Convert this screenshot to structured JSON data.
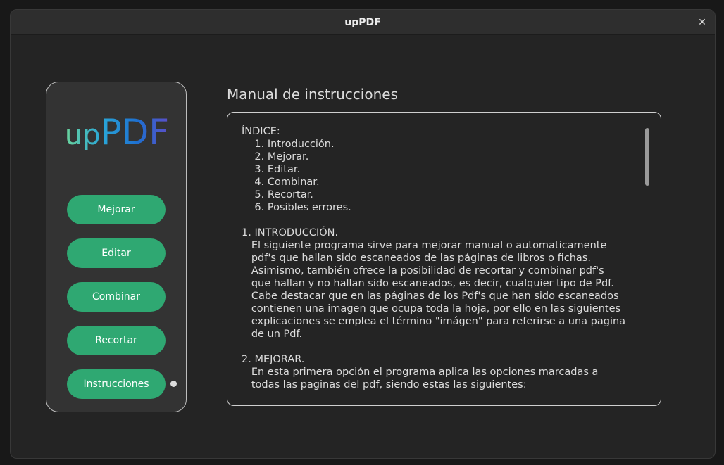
{
  "window": {
    "title": "upPDF",
    "minimize_glyph": "–",
    "close_glyph": "✕"
  },
  "sidebar": {
    "logo_text_left": "up",
    "logo_text_right": "PDF",
    "buttons": [
      {
        "label": "Mejorar"
      },
      {
        "label": "Editar"
      },
      {
        "label": "Combinar"
      },
      {
        "label": "Recortar"
      },
      {
        "label": "Instrucciones"
      }
    ]
  },
  "main": {
    "title": "Manual de instrucciones",
    "document_text": "ÍNDICE:\n    1. Introducción.\n    2. Mejorar.\n    3. Editar.\n    4. Combinar.\n    5. Recortar.\n    6. Posibles errores.\n\n1. INTRODUCCIÓN.\n   El siguiente programa sirve para mejorar manual o automaticamente\n   pdf's que hallan sido escaneados de las páginas de libros o fichas.\n   Asimismo, también ofrece la posibilidad de recortar y combinar pdf's\n   que hallan y no hallan sido escaneados, es decir, cualquier tipo de Pdf.\n   Cabe destacar que en las páginas de los Pdf's que han sido escaneados\n   contienen una imagen que ocupa toda la hoja, por ello en las siguientes\n   explicaciones se emplea el término \"imágen\" para referirse a una pagina\n   de un Pdf.\n\n2. MEJORAR.\n   En esta primera opción el programa aplica las opciones marcadas a\n   todas las paginas del pdf, siendo estas las siguientes:"
  },
  "colors": {
    "accent_green": "#2fa872",
    "logo_gradient": [
      "#6bd49a",
      "#2aa8d8",
      "#1e6fd0",
      "#5b4fc9"
    ]
  }
}
